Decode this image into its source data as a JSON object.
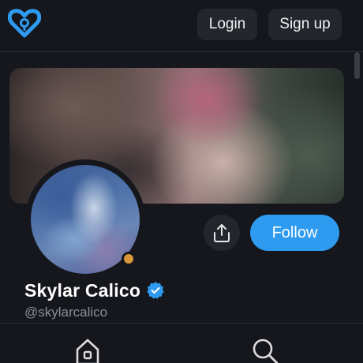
{
  "header": {
    "logo_icon": "heart-logo-icon",
    "login_label": "Login",
    "signup_label": "Sign up"
  },
  "profile": {
    "display_name": "Skylar Calico",
    "handle": "@skylarcalico",
    "verified": true,
    "status_color": "#d9973a",
    "follow_label": "Follow",
    "share_icon": "share-icon"
  },
  "bottom_nav": {
    "items": [
      {
        "icon": "home-icon"
      },
      {
        "icon": "search-icon"
      }
    ]
  },
  "colors": {
    "background": "#15171c",
    "accent": "#2e9bf0",
    "button_bg": "#23262d",
    "muted_text": "#8a8f98"
  }
}
